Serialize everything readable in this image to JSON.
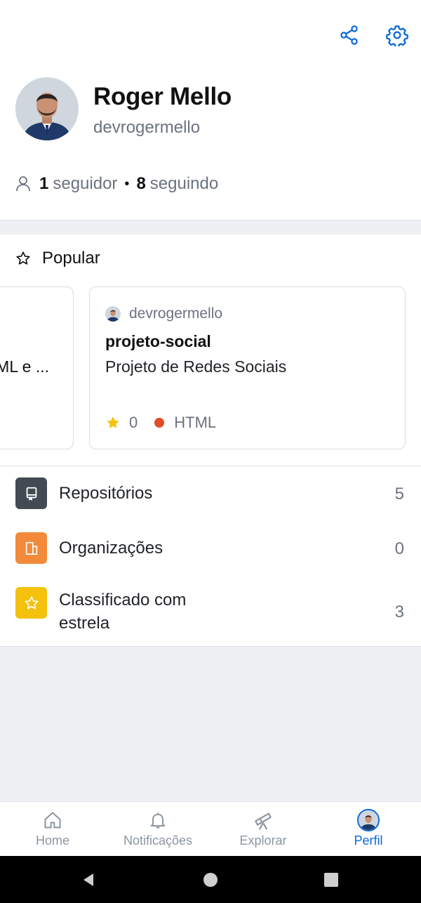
{
  "header": {
    "share_icon": "share-icon",
    "settings_icon": "gear-icon"
  },
  "profile": {
    "name": "Roger Mello",
    "login": "devrogermello",
    "followers_count": "1",
    "followers_label": "seguidor",
    "separator": "•",
    "following_count": "8",
    "following_label": "seguindo"
  },
  "popular": {
    "title": "Popular",
    "cards": [
      {
        "description_fragment": "ML e ..."
      },
      {
        "owner": "devrogermello",
        "name": "projeto-social",
        "description": "Projeto de Redes Sociais",
        "stars": "0",
        "language": "HTML",
        "language_color": "#e34c26"
      }
    ]
  },
  "menu": {
    "items": [
      {
        "label": "Repositórios",
        "count": "5",
        "icon": "repo-icon",
        "color": "#424a53"
      },
      {
        "label": "Organizações",
        "count": "0",
        "icon": "organization-icon",
        "color": "#f28a3a"
      },
      {
        "label": "Classificado com estrela",
        "count": "3",
        "icon": "star-icon",
        "color": "#f4c20d"
      }
    ]
  },
  "tabs": [
    {
      "label": "Home",
      "icon": "home-icon"
    },
    {
      "label": "Notificações",
      "icon": "bell-icon"
    },
    {
      "label": "Explorar",
      "icon": "telescope-icon"
    },
    {
      "label": "Perfil",
      "icon": "avatar",
      "active": true
    }
  ],
  "colors": {
    "accent": "#0969da",
    "star": "#f4c20d"
  }
}
